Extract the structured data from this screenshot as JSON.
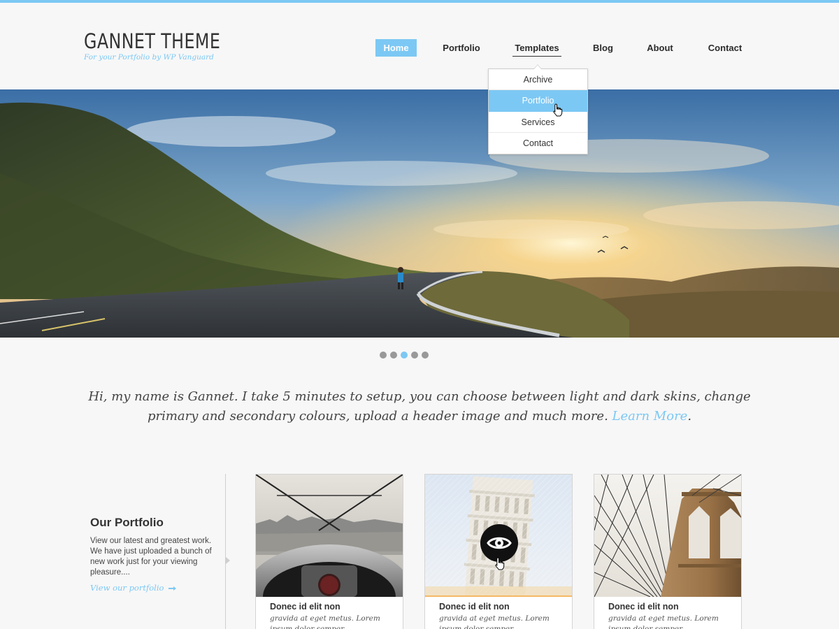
{
  "header": {
    "logo_title": "GANNET THEME",
    "logo_tagline": "For your Portfolio by WP Vanguard"
  },
  "nav": {
    "items": [
      {
        "label": "Home",
        "active": true
      },
      {
        "label": "Portfolio"
      },
      {
        "label": "Templates",
        "open": true
      },
      {
        "label": "Blog"
      },
      {
        "label": "About"
      },
      {
        "label": "Contact"
      }
    ],
    "dropdown": [
      "Archive",
      "Portfolio",
      "Services",
      "Contact"
    ],
    "dropdown_hover_index": 1
  },
  "slider": {
    "slide_count": 5,
    "active_index": 2
  },
  "intro": {
    "line1": "Hi, my name is Gannet. I take 5 minutes to setup, you can choose between light and dark skins, change",
    "line2": "primary and secondary colours, upload a header image and much more.",
    "link": "Learn More",
    "period": "."
  },
  "portfolio": {
    "heading": "Our Portfolio",
    "text": "View our latest and greatest work. We have just uploaded a bunch of new work just for your viewing pleasure....",
    "link": "View our portfolio",
    "cards": [
      {
        "title": "Donec id elit non",
        "desc": "gravida at eget metus. Lorem ipsum dolor semper"
      },
      {
        "title": "Donec id elit non",
        "desc": "gravida at eget metus. Lorem ipsum dolor semper"
      },
      {
        "title": "Donec id elit non",
        "desc": "gravida at eget metus. Lorem ipsum dolor semper"
      }
    ]
  },
  "colors": {
    "accent": "#7cc8f4",
    "highlight": "#f5b865",
    "text": "#333333",
    "background": "#f7f7f7"
  },
  "icons": {
    "cursor": "hand-pointer-icon",
    "view": "eye-icon",
    "link_arrow": "arrow-right-icon"
  }
}
